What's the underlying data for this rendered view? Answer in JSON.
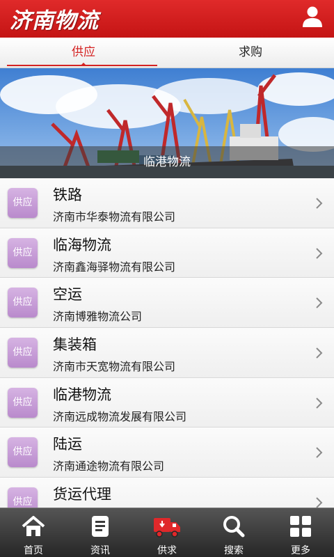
{
  "header": {
    "title": "济南物流",
    "user_icon": "user-icon"
  },
  "tabs": [
    {
      "label": "供应",
      "active": true
    },
    {
      "label": "求购",
      "active": false
    }
  ],
  "banner": {
    "caption": "临港物流"
  },
  "list": [
    {
      "badge": "供应",
      "title": "铁路",
      "subtitle": "济南市华泰物流有限公司"
    },
    {
      "badge": "供应",
      "title": "临海物流",
      "subtitle": "济南鑫海驿物流有限公司"
    },
    {
      "badge": "供应",
      "title": "空运",
      "subtitle": "济南博雅物流公司"
    },
    {
      "badge": "供应",
      "title": "集装箱",
      "subtitle": "济南市天宽物流有限公司"
    },
    {
      "badge": "供应",
      "title": "临港物流",
      "subtitle": "济南远成物流发展有限公司"
    },
    {
      "badge": "供应",
      "title": "陆运",
      "subtitle": "济南通途物流有限公司"
    },
    {
      "badge": "供应",
      "title": "货运代理",
      "subtitle": ""
    }
  ],
  "bottom_nav": [
    {
      "label": "首页",
      "icon": "home-icon",
      "active": false
    },
    {
      "label": "资讯",
      "icon": "news-icon",
      "active": false
    },
    {
      "label": "供求",
      "icon": "truck-icon",
      "active": true
    },
    {
      "label": "搜索",
      "icon": "search-icon",
      "active": false
    },
    {
      "label": "更多",
      "icon": "grid-icon",
      "active": false
    }
  ],
  "colors": {
    "brand_red": "#d42222",
    "badge_purple": "#c39bd5"
  }
}
